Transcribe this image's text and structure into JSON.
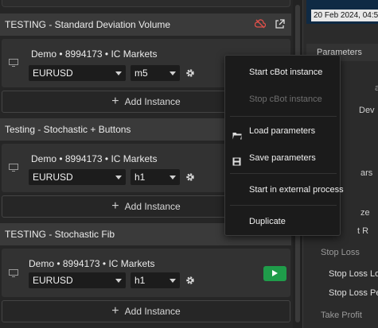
{
  "groups": [
    {
      "title": "TESTING - Standard Deviation Volume",
      "account": "Demo • 8994173 •  IC Markets",
      "symbol": "EURUSD",
      "timeframe": "m5",
      "add_label": "Add Instance"
    },
    {
      "title": "Testing - Stochastic + Buttons",
      "account": "Demo • 8994173 •  IC Markets",
      "symbol": "EURUSD",
      "timeframe": "h1",
      "add_label": "Add Instance"
    },
    {
      "title": "TESTING - Stochastic Fib",
      "account": "Demo • 8994173 •  IC Markets",
      "symbol": "EURUSD",
      "timeframe": "h1",
      "add_label": "Add Instance"
    }
  ],
  "context_menu": {
    "start": "Start cBot instance",
    "stop": "Stop cBot instance",
    "load": "Load parameters",
    "save": "Save parameters",
    "external": "Start in external process",
    "duplicate": "Duplicate"
  },
  "right_panel": {
    "date": "20 Feb 2024, 04:5",
    "parameters": "Parameters",
    "partial_1": "a",
    "partial_2": "Dev",
    "partial_3": "ars",
    "partial_4": "ze",
    "partial_5": "t R",
    "stop_loss_section": "Stop Loss",
    "stop_loss_item_1": "Stop Loss Lo",
    "stop_loss_item_2": "Stop Loss Pe",
    "take_profit_section": "Take Profit"
  },
  "colors": {
    "accent_green": "#1f9c4a",
    "background": "#262626",
    "header": "#3a3a3a"
  }
}
